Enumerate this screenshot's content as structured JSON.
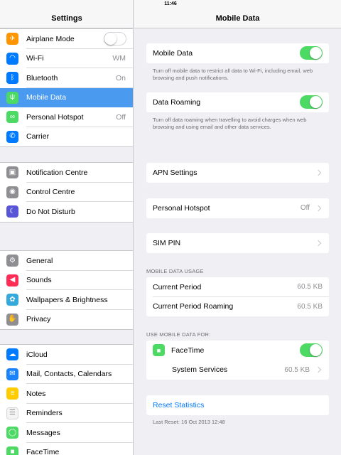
{
  "status_bar": {
    "time": "11:46"
  },
  "sidebar": {
    "title": "Settings",
    "groups": [
      [
        {
          "name": "airplane-mode",
          "label": "Airplane Mode",
          "icon": "airplane-icon",
          "color": "#ff9500",
          "glyph": "✈",
          "toggle": false
        },
        {
          "name": "wifi",
          "label": "Wi-Fi",
          "icon": "wifi-icon",
          "color": "#007aff",
          "glyph": "◠",
          "value": "WM"
        },
        {
          "name": "bluetooth",
          "label": "Bluetooth",
          "icon": "bluetooth-icon",
          "color": "#007aff",
          "glyph": "ᛒ",
          "value": "On"
        },
        {
          "name": "mobile-data",
          "label": "Mobile Data",
          "icon": "antenna-icon",
          "color": "#4cd964",
          "glyph": "ψ",
          "selected": true
        },
        {
          "name": "personal-hotspot",
          "label": "Personal Hotspot",
          "icon": "hotspot-icon",
          "color": "#4cd964",
          "glyph": "∞",
          "value": "Off"
        },
        {
          "name": "carrier",
          "label": "Carrier",
          "icon": "phone-icon",
          "color": "#007aff",
          "glyph": "✆"
        }
      ],
      [
        {
          "name": "notification-centre",
          "label": "Notification Centre",
          "icon": "notification-icon",
          "color": "#8e8e93",
          "glyph": "▣"
        },
        {
          "name": "control-centre",
          "label": "Control Centre",
          "icon": "control-icon",
          "color": "#8e8e93",
          "glyph": "◉"
        },
        {
          "name": "do-not-disturb",
          "label": "Do Not Disturb",
          "icon": "moon-icon",
          "color": "#5856d6",
          "glyph": "☾"
        }
      ],
      [
        {
          "name": "general",
          "label": "General",
          "icon": "gear-icon",
          "color": "#8e8e93",
          "glyph": "⚙"
        },
        {
          "name": "sounds",
          "label": "Sounds",
          "icon": "speaker-icon",
          "color": "#ff2d55",
          "glyph": "◀"
        },
        {
          "name": "wallpapers-brightness",
          "label": "Wallpapers & Brightness",
          "icon": "flower-icon",
          "color": "#34aadc",
          "glyph": "✿"
        },
        {
          "name": "privacy",
          "label": "Privacy",
          "icon": "hand-icon",
          "color": "#8e8e93",
          "glyph": "✋"
        }
      ],
      [
        {
          "name": "icloud",
          "label": "iCloud",
          "icon": "cloud-icon",
          "color": "#007aff",
          "glyph": "☁"
        },
        {
          "name": "mail-contacts-calendars",
          "label": "Mail, Contacts, Calendars",
          "icon": "mail-icon",
          "color": "#1a82fb",
          "glyph": "✉"
        },
        {
          "name": "notes",
          "label": "Notes",
          "icon": "notes-icon",
          "color": "#ffcc00",
          "glyph": "≡"
        },
        {
          "name": "reminders",
          "label": "Reminders",
          "icon": "list-icon",
          "color": "#f4f4f4",
          "glyph": "☰"
        },
        {
          "name": "messages",
          "label": "Messages",
          "icon": "message-icon",
          "color": "#4cd964",
          "glyph": "◯"
        },
        {
          "name": "facetime",
          "label": "FaceTime",
          "icon": "camera-icon",
          "color": "#4cd964",
          "glyph": "■"
        }
      ]
    ]
  },
  "detail": {
    "title": "Mobile Data",
    "mobile_data": {
      "label": "Mobile Data",
      "on": true,
      "note": "Turn off mobile data to restrict all data to Wi-Fi, including email, web browsing and push notifications."
    },
    "data_roaming": {
      "label": "Data Roaming",
      "on": true,
      "note": "Turn off data roaming when travelling to avoid charges when web browsing and using email and other data services."
    },
    "apn_settings": {
      "label": "APN Settings"
    },
    "personal_hotspot": {
      "label": "Personal Hotspot",
      "value": "Off"
    },
    "sim_pin": {
      "label": "SIM PIN"
    },
    "usage": {
      "section_title": "MOBILE DATA USAGE",
      "current_period": {
        "label": "Current Period",
        "value": "60.5 KB"
      },
      "current_period_roaming": {
        "label": "Current Period Roaming",
        "value": "60.5 KB"
      }
    },
    "use_for": {
      "section_title": "USE MOBILE DATA FOR:",
      "facetime": {
        "label": "FaceTime",
        "on": true
      },
      "system_services": {
        "label": "System Services",
        "value": "60.5 KB"
      }
    },
    "reset": {
      "label": "Reset Statistics",
      "last_reset": "Last Reset: 16 Oct 2013 12:48"
    }
  },
  "colors": {
    "accent": "#007aff",
    "selected_row": "#4a9af0",
    "toggle_on": "#4cd964"
  }
}
